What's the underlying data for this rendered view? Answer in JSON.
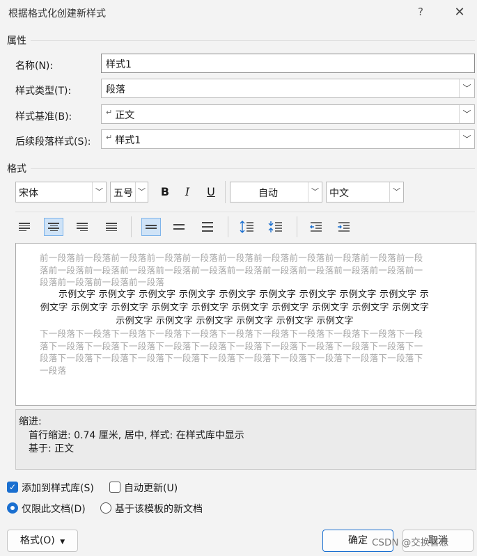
{
  "window": {
    "title": "根据格式化创建新样式",
    "help": "?",
    "close": "✕"
  },
  "properties": {
    "heading": "属性",
    "name_label": "名称(N):",
    "name_value": "样式1",
    "type_label": "样式类型(T):",
    "type_value": "段落",
    "base_label": "样式基准(B):",
    "base_value": "正文",
    "next_label": "后续段落样式(S):",
    "next_value": "样式1"
  },
  "format": {
    "heading": "格式",
    "font": "宋体",
    "size": "五号",
    "bold": "B",
    "italic": "I",
    "underline": "U",
    "color": "自动",
    "script": "中文"
  },
  "preview": {
    "prev_para": "前一段落前一段落前一段落前一段落前一段落前一段落前一段落前一段落前一段落前一段落前一段落前一段落前一段落前一段落前一段落前一段落前一段落前一段落前一段落前一段落前一段落前一段落前一段落前一段落前一段落",
    "sample": "示例文字 示例文字 示例文字 示例文字 示例文字 示例文字 示例文字 示例文字 示例文字 示例文字 示例文字 示例文字 示例文字 示例文字 示例文字 示例文字 示例文字 示例文字 示例文字 示例文字 示例文字 示例文字 示例文字 示例文字 示例文字",
    "next_para": "下一段落下一段落下一段落下一段落下一段落下一段落下一段落下一段落下一段落下一段落下一段落下一段落下一段落下一段落下一段落下一段落下一段落下一段落下一段落下一段落下一段落下一段落下一段落下一段落下一段落下一段落下一段落下一段落下一段落下一段落下一段落下一段落下一段落"
  },
  "description": {
    "line1": "缩进:",
    "line2": "首行缩进:  0.74 厘米, 居中, 样式: 在样式库中显示",
    "line3": "基于: 正文"
  },
  "options": {
    "add_to_gallery": "添加到样式库(S)",
    "auto_update": "自动更新(U)",
    "this_doc_only": "仅限此文档(D)",
    "new_docs_template": "基于该模板的新文档"
  },
  "buttons": {
    "format": "格式(O)",
    "ok": "确定",
    "cancel": "取消"
  },
  "watermark": "CSDN @交换喜悲",
  "colors": {
    "accent": "#1a6fd0",
    "preview_gray": "#a6a6a6"
  }
}
